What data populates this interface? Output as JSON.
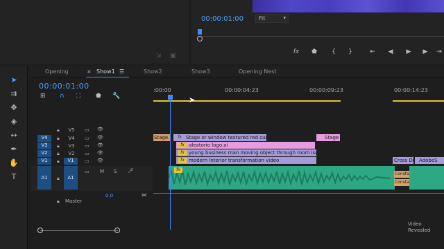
{
  "program_monitor": {
    "timecode": "00:00:01:00",
    "zoom_value": "Fit"
  },
  "timeline": {
    "tabs": [
      {
        "label": "Opening"
      },
      {
        "label": "Show1"
      },
      {
        "label": "Show2"
      },
      {
        "label": "Show3"
      },
      {
        "label": "Opening Nest"
      }
    ],
    "timecode": "00:00:01:00",
    "ruler_labels": [
      ":00:00",
      "00:00:04:23",
      "00:00:09:23",
      "00:00:14:23"
    ],
    "tracks": {
      "video": [
        {
          "source": "",
          "target": "V5"
        },
        {
          "source": "V4",
          "target": "V4"
        },
        {
          "source": "V3",
          "target": "V3"
        },
        {
          "source": "V2",
          "target": "V2"
        },
        {
          "source": "V1",
          "target": "V1"
        }
      ],
      "audio": [
        {
          "source": "A1",
          "target": "A1",
          "buttons": [
            "M",
            "S"
          ]
        }
      ],
      "master": {
        "label": "Master",
        "value": "0.0"
      }
    },
    "clips": {
      "v4_small_left": "Stage...",
      "v4_main": "Stage or window textured red curtains",
      "v4_right": "Stage F",
      "v3_main": "aleatorio logo.ai",
      "v2_main": "young business man moving object through room isolated a",
      "v1_main": "modern interior transformation video",
      "v1_right_a": "Cross Di",
      "v1_right_b": "AdobeS",
      "a1_label_a": "Consta",
      "a1_label_b": "Consta"
    },
    "fx_label": "fx"
  },
  "watermark": {
    "line1": "Video",
    "line2": "Revealed"
  },
  "colors": {
    "accent": "#3d8bff",
    "clip_purple": "#a69bd9",
    "clip_pink": "#e79be0",
    "audio_green": "#2ea883",
    "workarea_yellow": "#e1c53a"
  }
}
